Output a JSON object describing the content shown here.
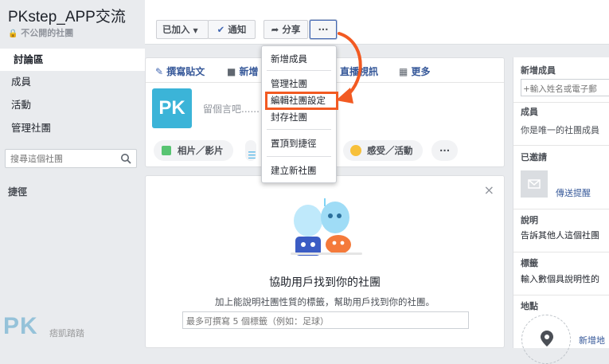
{
  "sidebar": {
    "group_name": "PKstep_APP交流",
    "privacy_label": "不公開的社團",
    "nav": [
      "討論區",
      "成員",
      "活動",
      "管理社團"
    ],
    "search_placeholder": "搜尋這個社團",
    "shortcuts_label": "捷徑"
  },
  "toolbar": {
    "joined_label": "已加入",
    "notify_label": "通知",
    "share_label": "分享",
    "more_label": "···"
  },
  "dropdown": {
    "items": [
      "新增成員",
      "管理社團",
      "編輯社團設定",
      "封存社團",
      "置頂到捷徑",
      "建立新社團"
    ],
    "highlight_color": "#f25a22"
  },
  "composer": {
    "tabs": [
      "撰寫貼文",
      "新增",
      "直播視訊",
      "更多"
    ],
    "placeholder": "留個言吧......",
    "chips": [
      "相片／影片",
      "感受／活動"
    ],
    "more_chip": "···"
  },
  "suggest": {
    "title": "協助用戶找到你的社團",
    "desc": "加上能說明社團性質的標籤，幫助用戶找到你的社團。",
    "tag_placeholder": "最多可撰寫 5 個標籤（例如：足球）",
    "close": "×"
  },
  "right": {
    "add_members_head": "新增成員",
    "add_members_placeholder": "+輸入姓名或電子郵",
    "members_head": "成員",
    "members_text": "你是唯一的社團成員",
    "invited_head": "已邀請",
    "send_reminder": "傳送提醒",
    "desc_head": "說明",
    "desc_text": "告訴其他人這個社團",
    "tags_head": "標籤",
    "tags_text": "輸入數個具說明性的",
    "location_head": "地點",
    "add_location": "新增地"
  },
  "watermark": {
    "logo": "PK",
    "text": "痞凱踏踏"
  }
}
